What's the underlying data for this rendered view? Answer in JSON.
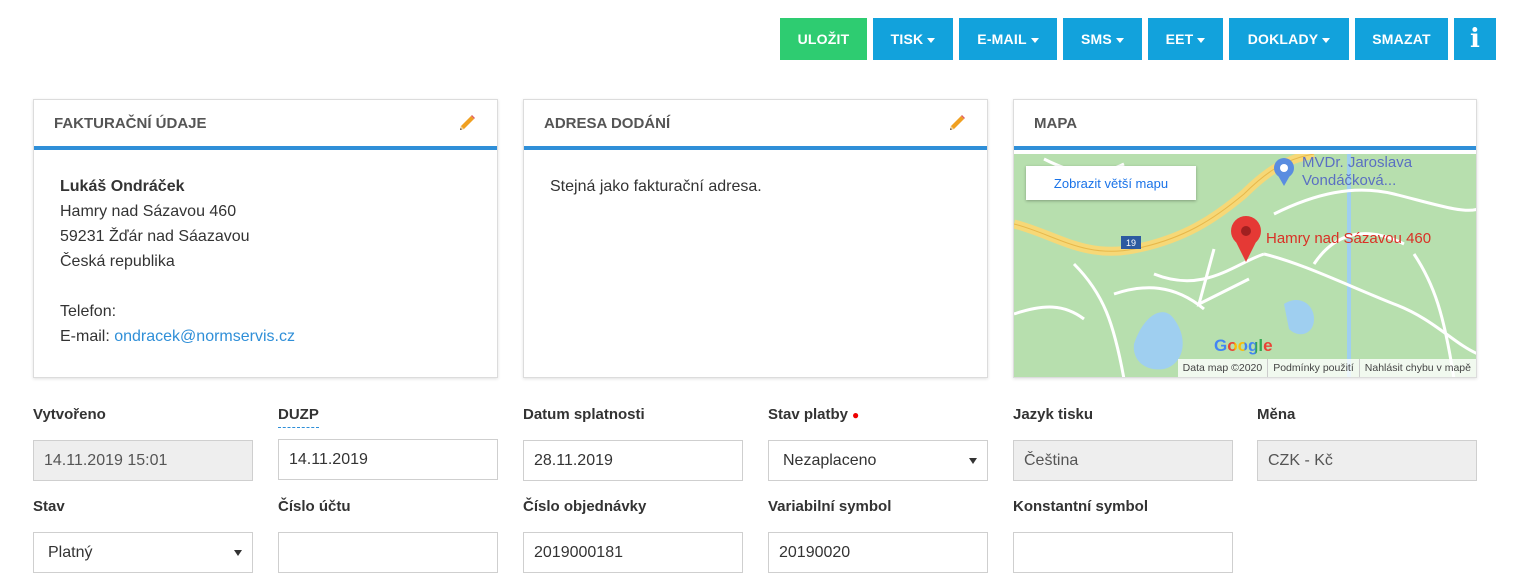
{
  "toolbar": {
    "save": "ULOŽIT",
    "print": "TISK",
    "email": "E-MAIL",
    "sms": "SMS",
    "eet": "EET",
    "documents": "DOKLADY",
    "delete": "SMAZAT",
    "info": "i"
  },
  "billing": {
    "title": "FAKTURAČNÍ ÚDAJE",
    "name": "Lukáš Ondráček",
    "street": "Hamry nad Sázavou 460",
    "city": "59231 Žďár nad Sáazavou",
    "country": "Česká republika",
    "phone_label": "Telefon:",
    "email_label": "E-mail:",
    "email": "ondracek@normservis.cz"
  },
  "delivery": {
    "title": "ADRESA DODÁNÍ",
    "text": "Stejná jako fakturační adresa."
  },
  "map": {
    "title": "MAPA",
    "bigger_map": "Zobrazit větší mapu",
    "marker_label": "Hamry nad Sázavou 460",
    "poi_line1": "MVDr. Jaroslava",
    "poi_line2": "Vondáčková...",
    "road_number": "19",
    "google": "Google",
    "footer": [
      "Data map ©2020",
      "Podmínky použití",
      "Nahlásit chybu v mapě"
    ]
  },
  "fields": {
    "created": {
      "label": "Vytvořeno",
      "value": "14.11.2019 15:01"
    },
    "duzp": {
      "label": "DUZP",
      "value": "14.11.2019"
    },
    "due": {
      "label": "Datum splatnosti",
      "value": "28.11.2019"
    },
    "payment": {
      "label": "Stav platby",
      "value": "Nezaplaceno"
    },
    "language": {
      "label": "Jazyk tisku",
      "value": "Čeština"
    },
    "currency": {
      "label": "Měna",
      "value": "CZK - Kč"
    },
    "state": {
      "label": "Stav",
      "value": "Platný"
    },
    "account": {
      "label": "Číslo účtu",
      "value": ""
    },
    "order": {
      "label": "Číslo objednávky",
      "value": "2019000181"
    },
    "variable": {
      "label": "Variabilní symbol",
      "value": "20190020"
    },
    "constant": {
      "label": "Konstantní symbol",
      "value": ""
    }
  },
  "colors": {
    "save": "#2ecc71",
    "button": "#12a2dc",
    "accent": "#2f8fd8",
    "required": "#ee0000"
  }
}
